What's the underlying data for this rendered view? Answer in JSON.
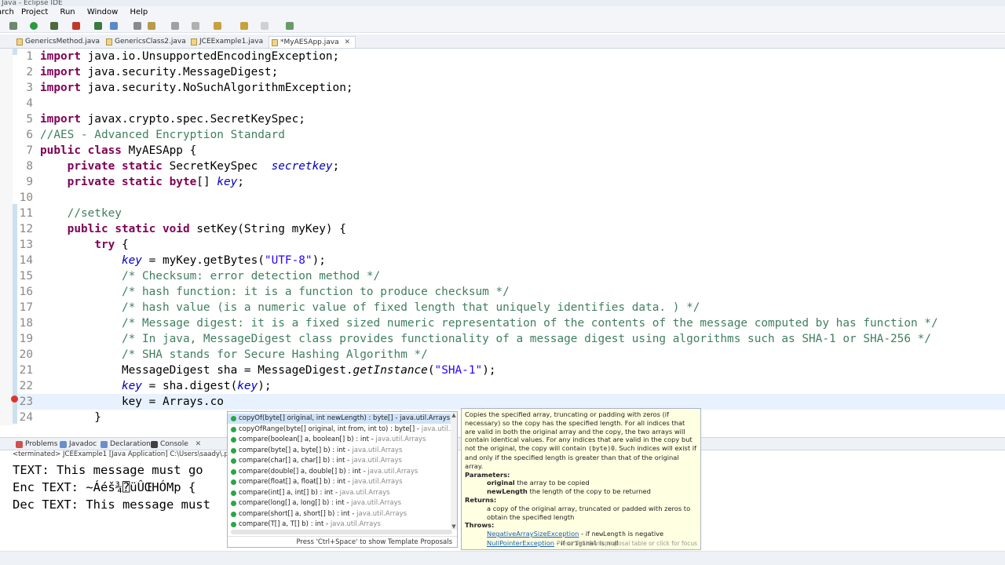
{
  "window": {
    "title": "Java - Eclipse IDE"
  },
  "menubar": [
    "arch",
    "Project",
    "Run",
    "Window",
    "Help"
  ],
  "editor_tabs": [
    {
      "label": "GenericsMethod.java"
    },
    {
      "label": "GenericsClass2.java"
    },
    {
      "label": "JCEExample1.java"
    },
    {
      "label": "*MyAESApp.java",
      "close": "✕"
    }
  ],
  "editor": {
    "lines": [
      {
        "num": "1",
        "segments": [
          {
            "t": "import",
            "c": "kw"
          },
          {
            "t": " java.io.UnsupportedEncodingException;"
          }
        ]
      },
      {
        "num": "2",
        "segments": [
          {
            "t": "import",
            "c": "kw"
          },
          {
            "t": " java.security.MessageDigest;"
          }
        ]
      },
      {
        "num": "3",
        "segments": [
          {
            "t": "import",
            "c": "kw"
          },
          {
            "t": " java.security.NoSuchAlgorithmException;"
          }
        ]
      },
      {
        "num": "4",
        "segments": []
      },
      {
        "num": "5",
        "segments": [
          {
            "t": "import",
            "c": "kw"
          },
          {
            "t": " javax.crypto.spec.SecretKeySpec;"
          }
        ]
      },
      {
        "num": "6",
        "segments": [
          {
            "t": "//AES - Advanced Encryption Standard",
            "c": "cm"
          }
        ]
      },
      {
        "num": "7",
        "segments": [
          {
            "t": "public",
            "c": "kw"
          },
          {
            "t": " "
          },
          {
            "t": "class",
            "c": "kw"
          },
          {
            "t": " MyAESApp {"
          }
        ]
      },
      {
        "num": "8",
        "segments": [
          {
            "t": "    "
          },
          {
            "t": "private",
            "c": "kw"
          },
          {
            "t": " "
          },
          {
            "t": "static",
            "c": "kw"
          },
          {
            "t": " SecretKeySpec  "
          },
          {
            "t": "secretkey",
            "c": "fld"
          },
          {
            "t": ";"
          }
        ]
      },
      {
        "num": "9",
        "segments": [
          {
            "t": "    "
          },
          {
            "t": "private",
            "c": "kw"
          },
          {
            "t": " "
          },
          {
            "t": "static",
            "c": "kw"
          },
          {
            "t": " "
          },
          {
            "t": "byte",
            "c": "kw"
          },
          {
            "t": "[] "
          },
          {
            "t": "key",
            "c": "fld"
          },
          {
            "t": ";"
          }
        ]
      },
      {
        "num": "10",
        "segments": []
      },
      {
        "num": "11",
        "segments": [
          {
            "t": "    "
          },
          {
            "t": "//setkey",
            "c": "cm"
          }
        ]
      },
      {
        "num": "12",
        "segments": [
          {
            "t": "    "
          },
          {
            "t": "public",
            "c": "kw"
          },
          {
            "t": " "
          },
          {
            "t": "static",
            "c": "kw"
          },
          {
            "t": " "
          },
          {
            "t": "void",
            "c": "kw"
          },
          {
            "t": " setKey(String myKey) {"
          }
        ]
      },
      {
        "num": "13",
        "segments": [
          {
            "t": "        "
          },
          {
            "t": "try",
            "c": "kw"
          },
          {
            "t": " {"
          }
        ]
      },
      {
        "num": "14",
        "segments": [
          {
            "t": "            "
          },
          {
            "t": "key",
            "c": "fld"
          },
          {
            "t": " = myKey.getBytes("
          },
          {
            "t": "\"UTF-8\"",
            "c": "str"
          },
          {
            "t": ");"
          }
        ]
      },
      {
        "num": "15",
        "segments": [
          {
            "t": "            "
          },
          {
            "t": "/* Checksum: error detection method */",
            "c": "cm"
          }
        ]
      },
      {
        "num": "16",
        "segments": [
          {
            "t": "            "
          },
          {
            "t": "/* hash function: it is a function to produce checksum */",
            "c": "cm"
          }
        ]
      },
      {
        "num": "17",
        "segments": [
          {
            "t": "            "
          },
          {
            "t": "/* hash value (is a numeric value of fixed length that uniquely identifies data. ) */",
            "c": "cm"
          }
        ]
      },
      {
        "num": "18",
        "segments": [
          {
            "t": "            "
          },
          {
            "t": "/* Message digest: it is a fixed sized numeric representation of the contents of the message computed by has function */",
            "c": "cm"
          }
        ]
      },
      {
        "num": "19",
        "segments": [
          {
            "t": "            "
          },
          {
            "t": "/* In java, MessageDigest class provides functionality of a message digest using algorithms such as SHA-1 or SHA-256 */",
            "c": "cm"
          }
        ]
      },
      {
        "num": "20",
        "segments": [
          {
            "t": "            "
          },
          {
            "t": "/* SHA stands for Secure Hashing Algorithm */",
            "c": "cm"
          }
        ]
      },
      {
        "num": "21",
        "segments": [
          {
            "t": "            MessageDigest sha = MessageDigest."
          },
          {
            "t": "getInstance",
            "c": "it"
          },
          {
            "t": "("
          },
          {
            "t": "\"SHA-1\"",
            "c": "str"
          },
          {
            "t": ");"
          }
        ]
      },
      {
        "num": "22",
        "segments": [
          {
            "t": "            "
          },
          {
            "t": "key",
            "c": "fld"
          },
          {
            "t": " = sha.digest("
          },
          {
            "t": "key",
            "c": "fld"
          },
          {
            "t": ");"
          }
        ]
      },
      {
        "num": "23",
        "segments": [
          {
            "t": "            key = Arrays.co"
          }
        ]
      },
      {
        "num": "24",
        "segments": [
          {
            "t": "        }"
          }
        ]
      }
    ]
  },
  "bottom_tabs": [
    {
      "label": "Problems",
      "color": "#d05050"
    },
    {
      "label": "Javadoc",
      "color": "#6a8fc8"
    },
    {
      "label": "Declaration",
      "color": "#6a8fc8"
    },
    {
      "label": "Console",
      "color": "#404040"
    }
  ],
  "console": {
    "status": "<terminated> JCEExample1 [Java Application] C:\\Users\\saady\\.p2\\pool\\",
    "lines": [
      "TEXT: This message must go",
      "Enc TEXT: ~Áéš¾⍰üÛŒHÓMp {",
      "Dec TEXT: This message must"
    ]
  },
  "completion": {
    "items": [
      {
        "sig": "copyOf(byte[] original, int newLength) : byte[] - java.util.Arrays",
        "cls": "",
        "selected": true
      },
      {
        "sig": "copyOfRange(byte[] original, int from, int to) : byte[] - ",
        "cls": "java.util.Arrays"
      },
      {
        "sig": "compare(boolean[] a, boolean[] b) : int - ",
        "cls": "java.util.Arrays"
      },
      {
        "sig": "compare(byte[] a, byte[] b) : int - ",
        "cls": "java.util.Arrays"
      },
      {
        "sig": "compare(char[] a, char[] b) : int - ",
        "cls": "java.util.Arrays"
      },
      {
        "sig": "compare(double[] a, double[] b) : int - ",
        "cls": "java.util.Arrays"
      },
      {
        "sig": "compare(float[] a, float[] b) : int - ",
        "cls": "java.util.Arrays"
      },
      {
        "sig": "compare(int[] a, int[] b) : int - ",
        "cls": "java.util.Arrays"
      },
      {
        "sig": "compare(long[] a, long[] b) : int - ",
        "cls": "java.util.Arrays"
      },
      {
        "sig": "compare(short[] a, short[] b) : int - ",
        "cls": "java.util.Arrays"
      },
      {
        "sig": "compare(T[] a, T[] b) : int - ",
        "cls": "java.util.Arrays"
      }
    ],
    "footer": "Press 'Ctrl+Space' to show Template Proposals"
  },
  "javadoc": {
    "description": "Copies the specified array, truncating or padding with zeros (if necessary) so the copy has the specified length. For all indices that are valid in both the original array and the copy, the two arrays will contain identical values. For any indices that are valid in the copy but not the original, the copy will contain",
    "code_zero": "(byte)0",
    "description2": ". Such indices will exist if and only if the specified length is greater than that of the original array.",
    "params_label": "Parameters:",
    "params": [
      {
        "name": "original",
        "desc": " the array to be copied"
      },
      {
        "name": "newLength",
        "desc": " the length of the copy to be returned"
      }
    ],
    "returns_label": "Returns:",
    "returns": "a copy of the original array, truncated or padded with zeros to obtain the specified length",
    "throws_label": "Throws:",
    "throws_link": "NegativeArraySizeException",
    "throws_text": " - if ",
    "throws_code": "newLength",
    "throws_text2": " is negative",
    "throws_link2": "NullPointerException",
    "throws_text3": " - if ",
    "throws_code2": "original",
    "throws_text4": " is null",
    "foot": "Press 'Tab' from proposal table or click for focus"
  }
}
